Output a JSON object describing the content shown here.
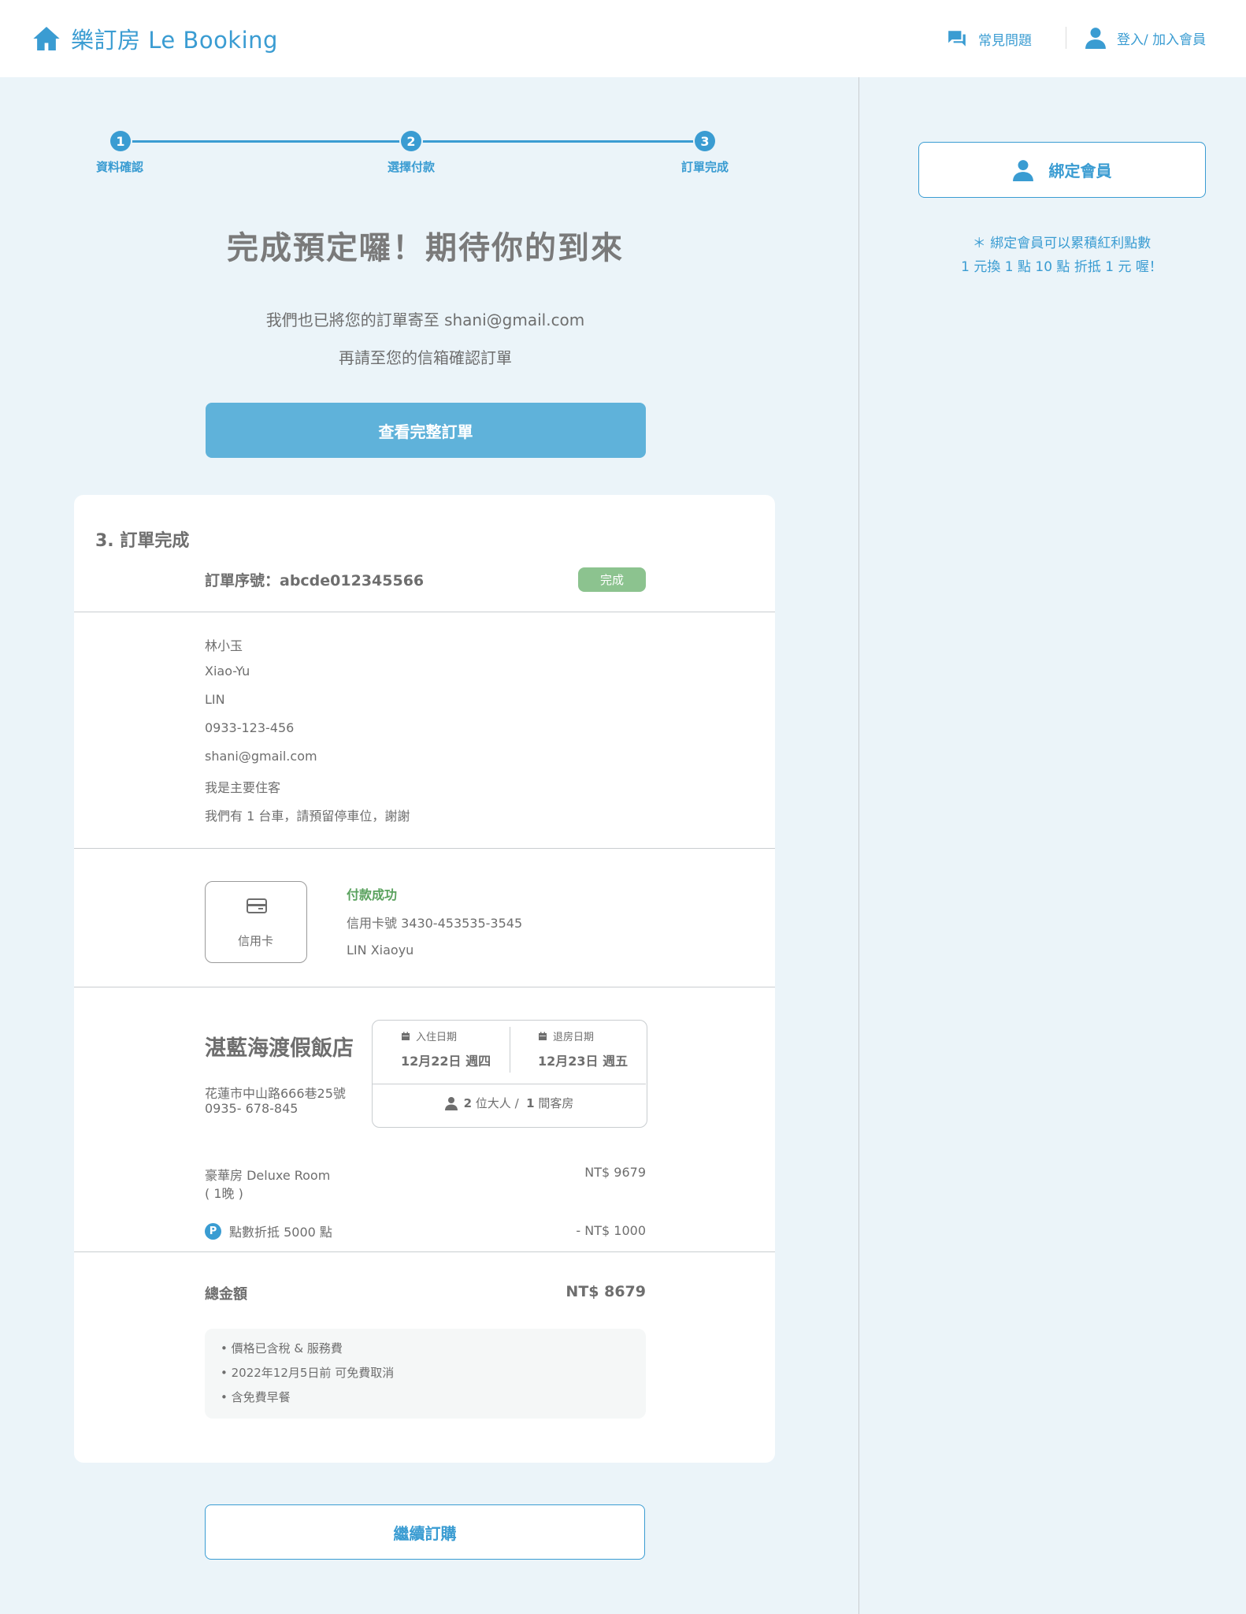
{
  "header": {
    "logo_text": "樂訂房 Le Booking",
    "faq_label": "常見問題",
    "login_label": "登入/ 加入會員"
  },
  "stepper": {
    "steps": [
      {
        "number": "1",
        "label": "資料確認"
      },
      {
        "number": "2",
        "label": "選擇付款"
      },
      {
        "number": "3",
        "label": "訂單完成"
      }
    ]
  },
  "confirmation": {
    "title": "完成預定囉！期待你的到來",
    "email_line": "我們也已將您的訂單寄至 shani@gmail.com",
    "check_line": "再請至您的信箱確認訂單",
    "view_button": "查看完整訂單"
  },
  "order": {
    "section_title": "3.  訂單完成",
    "order_number": "訂單序號：abcde012345566",
    "status_badge": "完成",
    "guest": {
      "chinese_name": "林小玉",
      "first_name": "Xiao-Yu",
      "last_name": "LIN",
      "phone": "0933-123-456",
      "email": "shani@gmail.com",
      "role": "我是主要住客",
      "note": "我們有 1 台車，請預留停車位，謝謝"
    },
    "payment": {
      "method_label": "信用卡",
      "status": "付款成功",
      "card_number": "信用卡號   3430-453535-3545",
      "card_holder": "LIN  Xiaoyu"
    },
    "hotel": {
      "name": "湛藍海渡假飯店",
      "address": "花蓮市中山路666巷25號",
      "phone": "0935- 678-845",
      "checkin_label": "入住日期",
      "checkin_date": "12月22日 週四",
      "checkout_label": "退房日期",
      "checkout_date": "12月23日 週五",
      "guests_bold_1": "2",
      "guests_text_1": " 位大人 /  ",
      "guests_bold_2": "1",
      "guests_text_2": " 間客房"
    },
    "pricing": {
      "room_name": "豪華房  Deluxe  Room",
      "room_nights": "( 1晚 )",
      "room_price": "NT$ 9679",
      "points_icon": "P",
      "points_label": "點數折抵  5000 點",
      "points_value": "- NT$ 1000",
      "total_label": "總金額",
      "total_value": "NT$  8679"
    },
    "notes": [
      "•  價格已含稅 & 服務費",
      "•  2022年12月5日前  可免費取消",
      "•  含免費早餐"
    ]
  },
  "continue_button": "繼續訂購",
  "sidebar": {
    "bind_button": "綁定會員",
    "note_line1": "＊ 綁定會員可以累積紅利點數",
    "note_line2": "1 元換 1 點  10 點 折抵 1 元 喔！"
  },
  "colors": {
    "accent": "#3a9cd2",
    "button_fill": "#5fb2da",
    "success_badge": "#8cc38f",
    "success_text": "#5aa25e",
    "background": "#ebf4f9"
  }
}
